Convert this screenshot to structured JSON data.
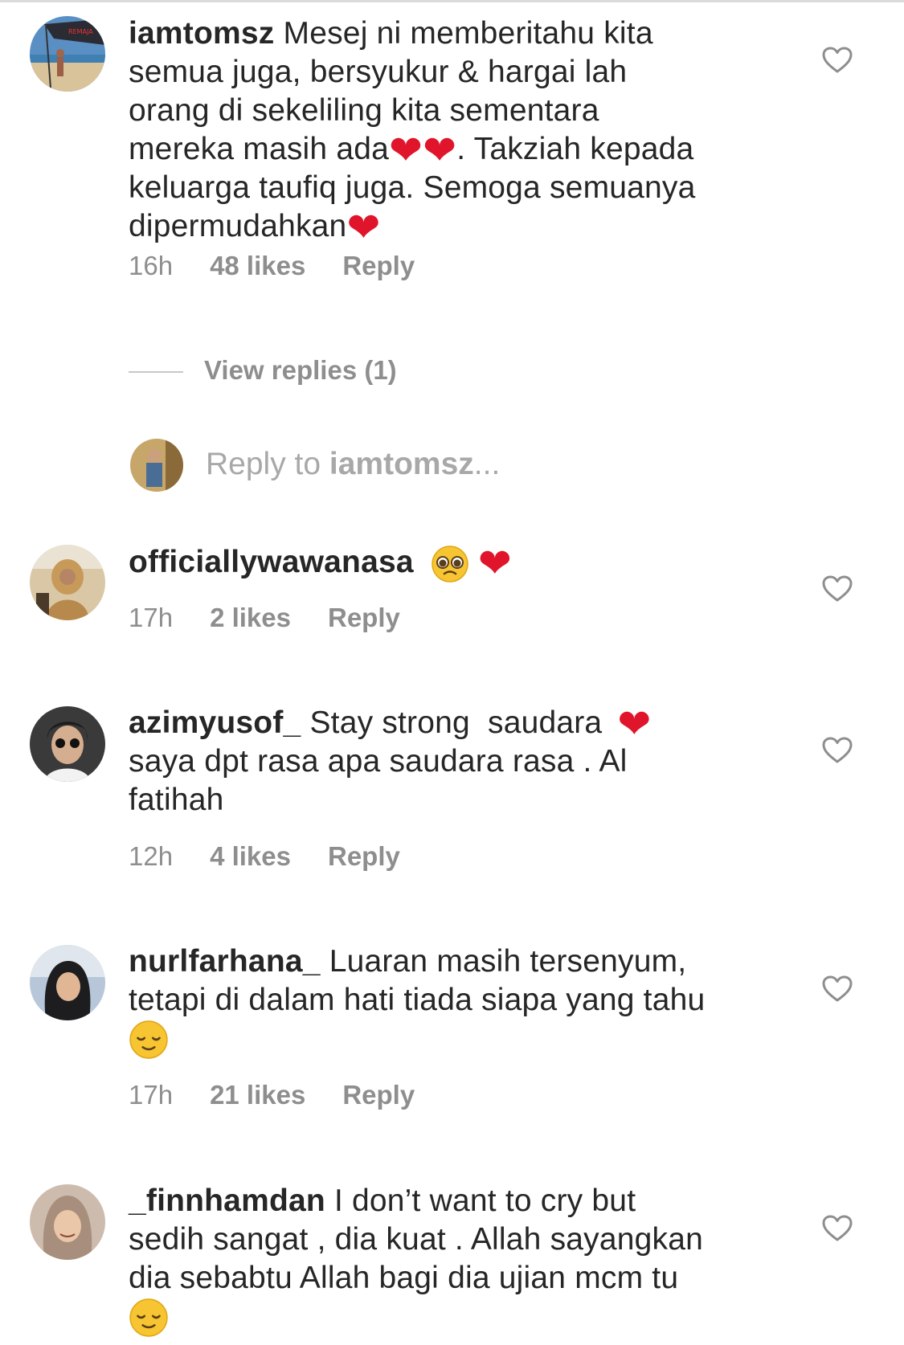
{
  "comments": [
    {
      "username": "iamtomsz",
      "lines": [
        "Mesej ni memberitahu kita",
        "semua juga, bersyukur & hargai lah",
        "orang di sekeliling kita sementara",
        "mereka masih ada",
        ". Takziah kepada",
        "keluarga taufiq juga. Semoga semuanya",
        "dipermudahkan"
      ],
      "time": "16h",
      "likes": "48 likes",
      "reply": "Reply",
      "like_icon": "heart-outline-icon"
    },
    {
      "username": "officiallywawanasa",
      "text": "",
      "time": "17h",
      "likes": "2 likes",
      "reply": "Reply",
      "like_icon": "heart-outline-icon"
    },
    {
      "username": "azimyusof_",
      "lines": [
        "Stay strong  saudara",
        "saya dpt rasa apa saudara rasa . Al",
        "fatihah"
      ],
      "time": "12h",
      "likes": "4 likes",
      "reply": "Reply",
      "like_icon": "heart-outline-icon"
    },
    {
      "username": "nurlfarhana_",
      "lines": [
        "Luaran masih tersenyum,",
        "tetapi di dalam hati tiada siapa yang tahu"
      ],
      "time": "17h",
      "likes": "21 likes",
      "reply": "Reply",
      "like_icon": "heart-outline-icon"
    },
    {
      "username": "_finnhamdan",
      "lines": [
        "I don’t want to cry but",
        "sedih sangat , dia kuat . Allah sayangkan",
        "dia sebabtu Allah bagi dia ujian mcm tu"
      ],
      "like_icon": "heart-outline-icon"
    }
  ],
  "thread": {
    "view_replies": "View replies (1)",
    "reply_prompt_prefix": "Reply to ",
    "reply_prompt_user": "iamtomsz",
    "reply_prompt_suffix": "..."
  },
  "emoji": {
    "heart": "❤",
    "pleading": "🥺",
    "relieved": "😌"
  },
  "colors": {
    "text": "#262626",
    "meta": "#8e8e8e",
    "placeholder": "#a8a8a8",
    "heart_emoji": "#e0142a"
  }
}
